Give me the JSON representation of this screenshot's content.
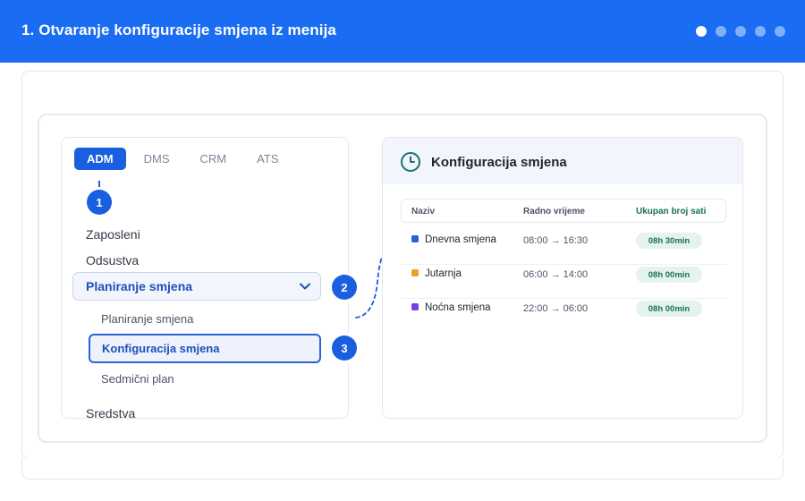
{
  "header": {
    "title": "1. Otvaranje konfiguracije smjena iz menija",
    "steps": [
      {
        "active": true
      },
      {
        "active": false
      },
      {
        "active": false
      },
      {
        "active": false
      },
      {
        "active": false
      }
    ]
  },
  "menu": {
    "tabs": [
      {
        "label": "ADM",
        "active": true
      },
      {
        "label": "DMS",
        "active": false
      },
      {
        "label": "CRM",
        "active": false
      },
      {
        "label": "ATS",
        "active": false
      }
    ],
    "items": [
      "Zaposleni",
      "Odsustva"
    ],
    "group": {
      "label": "Planiranje smjena",
      "chevron_icon": "chevron-down-icon",
      "sub_items": [
        "Planiranje smjena",
        "Konfiguracija smjena",
        "Sedmični plan"
      ],
      "selected": "Konfiguracija smjena"
    },
    "after_group_item": "Sredstva"
  },
  "badges": [
    "1",
    "2",
    "3"
  ],
  "config": {
    "icon": "clock-icon",
    "title": "Konfiguracija smjena",
    "columns": [
      "Naziv",
      "Radno vrijeme",
      "Ukupan broj sati"
    ],
    "rows": [
      {
        "name": "Dnevna smjena",
        "time": "08:00 → 16:30",
        "total": "08h 30min",
        "color": "#2a5fd8"
      },
      {
        "name": "Jutarnja",
        "time": "06:00 → 14:00",
        "total": "08h 00min",
        "color": "#f0a020"
      },
      {
        "name": "Noćna smjena",
        "time": "22:00 → 06:00",
        "total": "08h 00min",
        "color": "#7b3fe0"
      }
    ]
  },
  "colors": {
    "header": "#1a6cf2",
    "primary": "#1a5fe0",
    "pill_bg": "#e4f3ee",
    "pill_text": "#1b6f5c"
  }
}
